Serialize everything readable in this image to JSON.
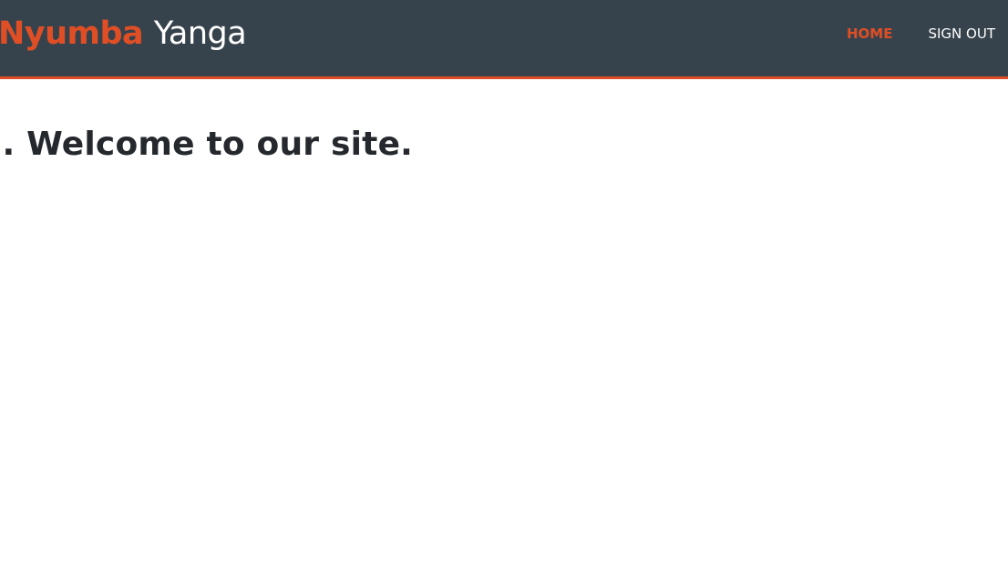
{
  "header": {
    "brand_part1": "Nyumba",
    "brand_part2": "Yanga",
    "nav": {
      "home_label": "HOME",
      "signout_label": "SIGN OUT"
    }
  },
  "main": {
    "welcome_text": "i. Welcome to our site."
  },
  "colors": {
    "navbar_bg": "#37434c",
    "accent": "#e04e25",
    "text": "#25292e"
  }
}
